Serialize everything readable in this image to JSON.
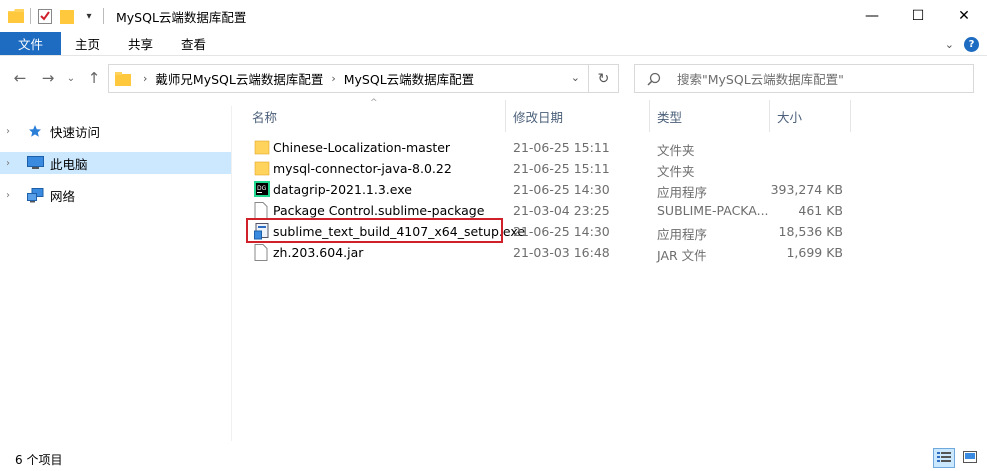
{
  "window": {
    "title": "MySQL云端数据库配置",
    "controls": {
      "minimize": "—",
      "maximize": "☐",
      "close": "✕"
    }
  },
  "ribbon": {
    "tabs": [
      "文件",
      "主页",
      "共享",
      "查看"
    ]
  },
  "address": {
    "crumbs": [
      "戴师兄MySQL云端数据库配置",
      "MySQL云端数据库配置"
    ],
    "search_placeholder": "搜索\"MySQL云端数据库配置\""
  },
  "nav": {
    "items": [
      {
        "label": "快速访问",
        "icon": "star-icon",
        "selected": false
      },
      {
        "label": "此电脑",
        "icon": "computer-icon",
        "selected": true
      },
      {
        "label": "网络",
        "icon": "network-icon",
        "selected": false
      }
    ]
  },
  "columns": {
    "name": "名称",
    "date": "修改日期",
    "type": "类型",
    "size": "大小"
  },
  "files": [
    {
      "name": "Chinese-Localization-master",
      "date": "21-06-25 15:11",
      "type": "文件夹",
      "size": "",
      "icon": "folder-icon"
    },
    {
      "name": "mysql-connector-java-8.0.22",
      "date": "21-06-25 15:11",
      "type": "文件夹",
      "size": "",
      "icon": "folder-icon"
    },
    {
      "name": "datagrip-2021.1.3.exe",
      "date": "21-06-25 14:30",
      "type": "应用程序",
      "size": "393,274 KB",
      "icon": "datagrip-icon"
    },
    {
      "name": "Package Control.sublime-package",
      "date": "21-03-04 23:25",
      "type": "SUBLIME-PACKA...",
      "size": "461 KB",
      "icon": "file-icon"
    },
    {
      "name": "sublime_text_build_4107_x64_setup.exe",
      "date": "21-06-25 14:30",
      "type": "应用程序",
      "size": "18,536 KB",
      "icon": "installer-icon"
    },
    {
      "name": "zh.203.604.jar",
      "date": "21-03-03 16:48",
      "type": "JAR 文件",
      "size": "1,699 KB",
      "icon": "file-icon"
    }
  ],
  "status": {
    "count": "6 个项目"
  },
  "colors": {
    "accent": "#1e6cc2",
    "selection": "#cce8ff",
    "highlight_border": "#d0202a",
    "folder": "#ffd35c"
  }
}
